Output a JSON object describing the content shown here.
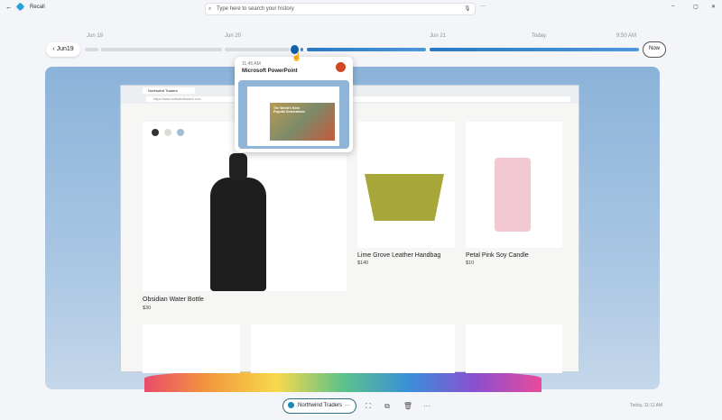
{
  "app": {
    "title": "Recall",
    "search_placeholder": "Type here to search your history"
  },
  "window_controls": {
    "minimize": "–",
    "maximize": "▢",
    "close": "✕"
  },
  "timeline": {
    "back_label": "Jun19",
    "labels": [
      "Jun 19",
      "Jun 20",
      "Jun 21",
      "Today",
      "9:50 AM"
    ],
    "now_label": "Now",
    "accent": "#2a78c2"
  },
  "hover_preview": {
    "time": "11:45 AM",
    "app": "Microsoft PowerPoint",
    "slide_title": "The World's Most Popular Destinations"
  },
  "browser": {
    "tab": "Northwind Traders",
    "url": "https://www.northwindtraders.com"
  },
  "products": [
    {
      "name": "Obsidian Water Bottle",
      "price": "$30"
    },
    {
      "name": "Lime Grove Leather Handbag",
      "price": "$140"
    },
    {
      "name": "Petal Pink Soy Candle",
      "price": "$10"
    }
  ],
  "swatches": [
    "#333333",
    "#dcdcd6",
    "#9fbfd8"
  ],
  "bottom_bar": {
    "app_pill": "Northwind Traders",
    "timestamp": "Today, 11:11 AM"
  }
}
